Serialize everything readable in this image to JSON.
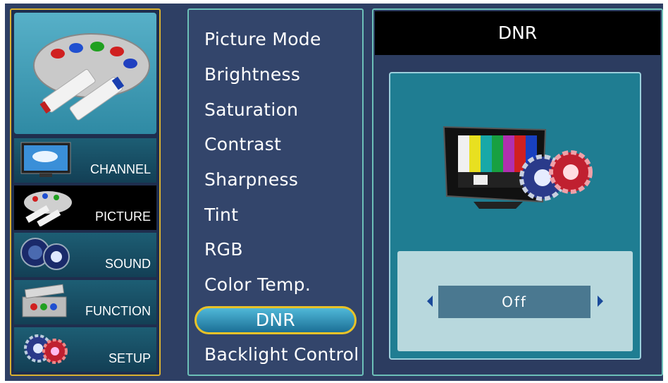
{
  "nav": {
    "items": [
      {
        "label": "CHANNEL",
        "icon": "tv-icon"
      },
      {
        "label": "PICTURE",
        "icon": "palette-icon"
      },
      {
        "label": "SOUND",
        "icon": "speaker-icon"
      },
      {
        "label": "FUNCTION",
        "icon": "toolbox-icon"
      },
      {
        "label": "SETUP",
        "icon": "gears-icon"
      }
    ],
    "active": "PICTURE"
  },
  "menu": {
    "items": [
      "Picture Mode",
      "Brightness",
      "Saturation",
      "Contrast",
      "Sharpness",
      "Tint",
      "RGB",
      "Color Temp.",
      "DNR",
      "Backlight Control"
    ],
    "selected": "DNR"
  },
  "panel": {
    "title": "DNR",
    "value": "Off"
  },
  "colors": {
    "frame": "#2e3f64",
    "accent_gold": "#e8c228",
    "selected_pill": "#1c6f96",
    "panel_teal": "#1f7d92"
  }
}
